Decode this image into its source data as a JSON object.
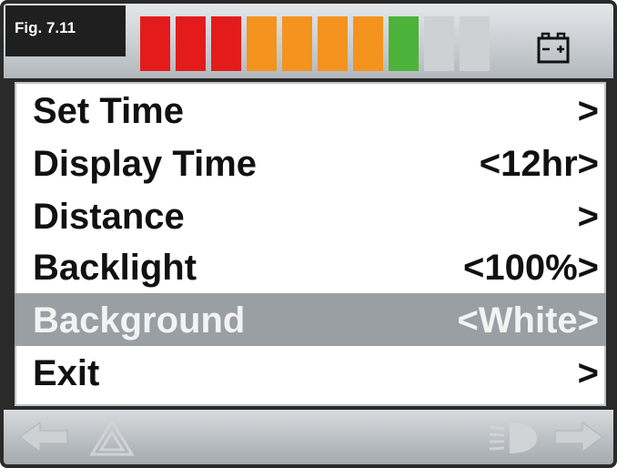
{
  "header": {
    "figure_label": "Fig. 7.11",
    "battery_segments": [
      "red",
      "red",
      "red",
      "orange",
      "orange",
      "orange",
      "orange",
      "green",
      "grey",
      "grey"
    ],
    "battery_icon": "battery-icon"
  },
  "menu": {
    "items": [
      {
        "label": "Set Time",
        "value": ">"
      },
      {
        "label": "Display Time",
        "value": "<12hr>"
      },
      {
        "label": "Distance",
        "value": ">"
      },
      {
        "label": "Backlight",
        "value": "<100%>"
      },
      {
        "label": "Background",
        "value": "<White>",
        "selected": true
      },
      {
        "label": "Exit",
        "value": ">"
      }
    ]
  },
  "footer": {
    "icons": [
      "left-arrow-icon",
      "hazard-warning-icon",
      "headlight-icon",
      "right-arrow-icon"
    ]
  },
  "colors": {
    "battery_red": "#e41b1b",
    "battery_orange": "#f4931e",
    "battery_green": "#4bb339",
    "selection_background": "#9a9fa3"
  }
}
